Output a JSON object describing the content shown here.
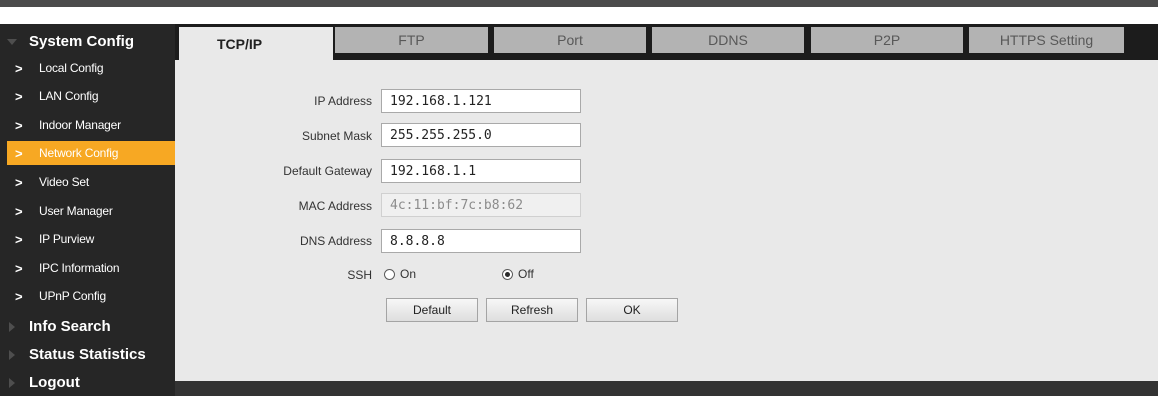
{
  "sidebar": {
    "system_config": "System Config",
    "items": [
      "Local Config",
      "LAN Config",
      "Indoor Manager",
      "Network Config",
      "Video Set",
      "User Manager",
      "IP Purview",
      "IPC Information",
      "UPnP Config"
    ],
    "active_item": "Network Config",
    "info_search": "Info Search",
    "status_statistics": "Status Statistics",
    "logout": "Logout"
  },
  "tabs": [
    "TCP/IP",
    "FTP",
    "Port",
    "DDNS",
    "P2P",
    "HTTPS Setting"
  ],
  "active_tab": "TCP/IP",
  "form": {
    "ip_label": "IP Address",
    "ip_value": "192.168.1.121",
    "subnet_label": "Subnet Mask",
    "subnet_value": "255.255.255.0",
    "gateway_label": "Default Gateway",
    "gateway_value": "192.168.1.1",
    "mac_label": "MAC Address",
    "mac_value": "4c:11:bf:7c:b8:62",
    "dns_label": "DNS Address",
    "dns_value": "8.8.8.8",
    "ssh_label": "SSH",
    "ssh_on": "On",
    "ssh_off": "Off",
    "ssh_selected": "Off"
  },
  "buttons": {
    "default": "Default",
    "refresh": "Refresh",
    "ok": "OK"
  },
  "colors": {
    "accent": "#f7a823",
    "sidebar_bg": "#262626",
    "content_bg": "#e9e9e9",
    "tab_bg": "#b3b3b3"
  }
}
